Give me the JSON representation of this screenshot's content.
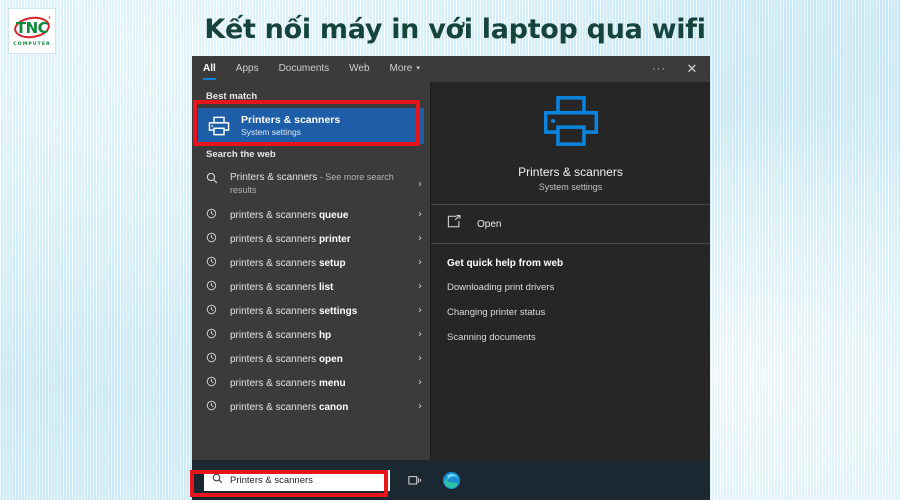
{
  "heading": "Kết nối máy in với laptop qua wifi",
  "logo": {
    "brand": "TNC",
    "sub": "COMPUTER",
    "registered": "®"
  },
  "window": {
    "tabs": [
      {
        "label": "All",
        "active": true
      },
      {
        "label": "Apps",
        "active": false
      },
      {
        "label": "Documents",
        "active": false
      },
      {
        "label": "Web",
        "active": false
      },
      {
        "label": "More",
        "active": false,
        "caret": "▾"
      }
    ],
    "more_dots": "···",
    "close_label": "✕"
  },
  "results": {
    "best_match_label": "Best match",
    "best_match": {
      "title": "Printers & scanners",
      "subtitle": "System settings"
    },
    "search_web_label": "Search the web",
    "web_items": [
      {
        "query": "Printers & scanners",
        "suffix": " - See more search results",
        "tall": true,
        "icon": "search-icon",
        "chevron": "›"
      },
      {
        "prefix": "printers & scanners ",
        "bold": "queue",
        "icon": "history-icon",
        "chevron": "›"
      },
      {
        "prefix": "printers & scanners ",
        "bold": "printer",
        "icon": "history-icon",
        "chevron": "›"
      },
      {
        "prefix": "printers & scanners ",
        "bold": "setup",
        "icon": "history-icon",
        "chevron": "›"
      },
      {
        "prefix": "printers & scanners ",
        "bold": "list",
        "icon": "history-icon",
        "chevron": "›"
      },
      {
        "prefix": "printers & scanners ",
        "bold": "settings",
        "icon": "history-icon",
        "chevron": "›"
      },
      {
        "prefix": "printers & scanners ",
        "bold": "hp",
        "icon": "history-icon",
        "chevron": "›"
      },
      {
        "prefix": "printers & scanners ",
        "bold": "open",
        "icon": "history-icon",
        "chevron": "›"
      },
      {
        "prefix": "printers & scanners ",
        "bold": "menu",
        "icon": "history-icon",
        "chevron": "›"
      },
      {
        "prefix": "printers & scanners ",
        "bold": "canon",
        "icon": "history-icon",
        "chevron": "›"
      }
    ]
  },
  "preview": {
    "title": "Printers & scanners",
    "subtitle": "System settings",
    "open_label": "Open",
    "help_title": "Get quick help from web",
    "help_links": [
      "Downloading print drivers",
      "Changing printer status",
      "Scanning documents"
    ]
  },
  "taskbar": {
    "search_value": "Printers & scanners"
  },
  "colors": {
    "accent_blue": "#0a84d8",
    "selection_blue": "#1e5ea8",
    "printer_icon_blue": "#0b84e0",
    "annotation_red": "#e8141c",
    "panel_left": "#3b3b3b",
    "panel_right": "#262626",
    "taskbar": "#1b2831",
    "heading_green": "#16443c",
    "logo_green": "#0a8a3c",
    "logo_red": "#d8232a"
  }
}
